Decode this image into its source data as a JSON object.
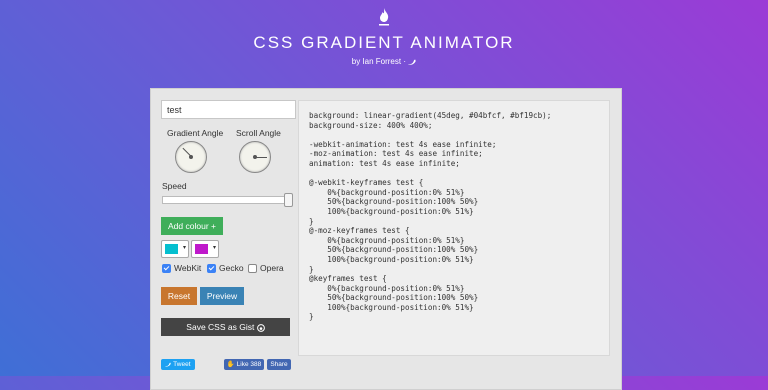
{
  "header": {
    "title": "CSS GRADIENT ANIMATOR",
    "byline": "by Ian Forrest ·"
  },
  "controls": {
    "name_value": "test",
    "gradient_angle_label": "Gradient Angle",
    "scroll_angle_label": "Scroll Angle",
    "gradient_angle_deg": 45,
    "scroll_angle_deg": 0,
    "speed_label": "Speed",
    "speed_level": 1.0,
    "add_colour_label": "Add colour +",
    "colours": [
      "#04bfcf",
      "#bf19cb"
    ],
    "swatch_arrow": "▾",
    "prefixes": [
      {
        "label": "WebKit",
        "checked": true
      },
      {
        "label": "Gecko",
        "checked": true
      },
      {
        "label": "Opera",
        "checked": false
      }
    ],
    "reset_label": "Reset",
    "preview_label": "Preview",
    "save_gist_label": "Save CSS as Gist"
  },
  "code": {
    "text": "background: linear-gradient(45deg, #04bfcf, #bf19cb);\nbackground-size: 400% 400%;\n\n-webkit-animation: test 4s ease infinite;\n-moz-animation: test 4s ease infinite;\nanimation: test 4s ease infinite;\n\n@-webkit-keyframes test {\n    0%{background-position:0% 51%}\n    50%{background-position:100% 50%}\n    100%{background-position:0% 51%}\n}\n@-moz-keyframes test {\n    0%{background-position:0% 51%}\n    50%{background-position:100% 50%}\n    100%{background-position:0% 51%}\n}\n@keyframes test {\n    0%{background-position:0% 51%}\n    50%{background-position:100% 50%}\n    100%{background-position:0% 51%}\n}"
  },
  "social": {
    "tweet_label": "Tweet",
    "like_label": "Like 388",
    "share_label": "Share"
  },
  "colors": {
    "green": "#3fae5a",
    "orange": "#c8762e",
    "blue": "#3a83b5",
    "dark": "#444444",
    "twitter": "#1da1f2",
    "facebook": "#4267b2"
  }
}
